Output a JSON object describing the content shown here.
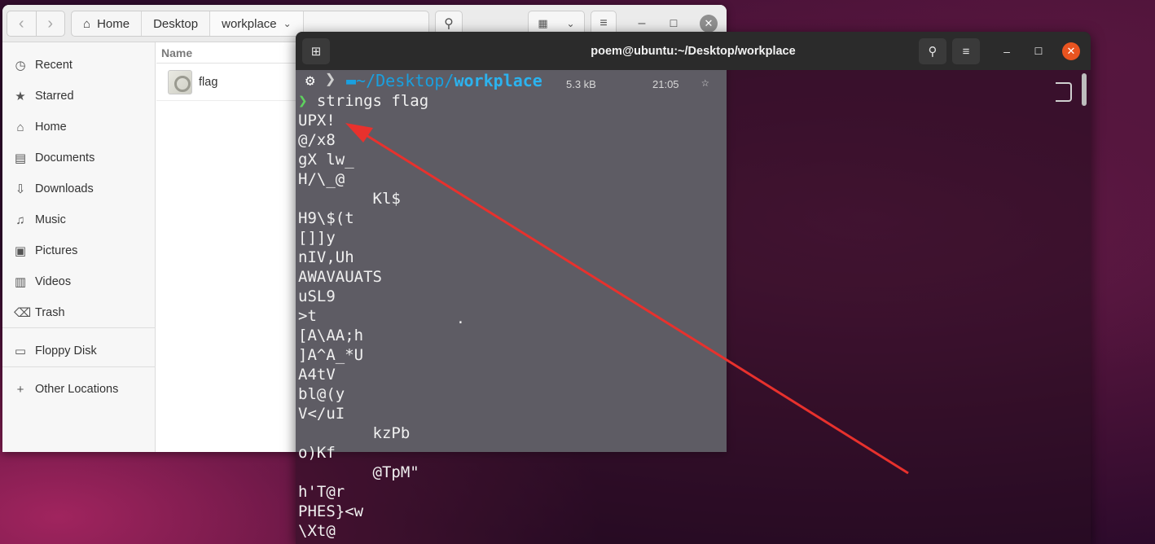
{
  "files_window": {
    "path": [
      "Home",
      "Desktop",
      "workplace"
    ],
    "sidebar": [
      {
        "label": "Recent",
        "icon": "clock-icon",
        "glyph": "◷"
      },
      {
        "label": "Starred",
        "icon": "star-icon",
        "glyph": "★"
      },
      {
        "label": "Home",
        "icon": "home-icon",
        "glyph": "⌂"
      },
      {
        "label": "Documents",
        "icon": "document-icon",
        "glyph": "▤"
      },
      {
        "label": "Downloads",
        "icon": "download-icon",
        "glyph": "⇩"
      },
      {
        "label": "Music",
        "icon": "music-icon",
        "glyph": "♫"
      },
      {
        "label": "Pictures",
        "icon": "picture-icon",
        "glyph": "▣"
      },
      {
        "label": "Videos",
        "icon": "video-icon",
        "glyph": "▥"
      },
      {
        "label": "Trash",
        "icon": "trash-icon",
        "glyph": "⌫"
      },
      {
        "label": "Floppy Disk",
        "icon": "floppy-icon",
        "glyph": "▭"
      },
      {
        "label": "Other Locations",
        "icon": "plus-icon",
        "glyph": "+"
      }
    ],
    "column_header": "Name",
    "files": [
      {
        "name": "flag"
      }
    ]
  },
  "terminal": {
    "title": "poem@ubuntu:~/Desktop/workplace",
    "prompt": {
      "path_prefix": "~/Desktop/",
      "path_current": "workplace",
      "size": "5.3 kB",
      "time": "21:05"
    },
    "command_symbol": "❯",
    "command": "strings flag",
    "output": [
      "UPX!",
      "@/x8",
      "gX lw_",
      "H/\\_@",
      "        Kl$",
      "H9\\$(t",
      "[]]y",
      "nIV,Uh",
      "AWAVAUATS",
      "uSL9",
      ">t",
      "[A\\AA;h",
      "]A^A_*U",
      "A4tV",
      "bl@(y",
      "V</uI",
      "        kzPb",
      "o)Kf",
      "        @TpM\"",
      "h'T@r",
      "PHES}<w",
      "\\Xt@"
    ]
  },
  "colors": {
    "accent_close": "#e95420",
    "prompt_path": "#1aa0df",
    "prompt_chevron": "#5ed15e",
    "annotation_arrow": "#e8312d"
  }
}
